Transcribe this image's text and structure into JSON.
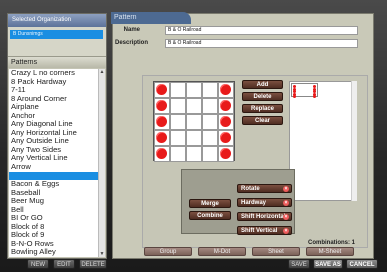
{
  "left_panel": {
    "org_header": "Selected Organization",
    "org_selected": "B Dunsnimgs",
    "patterns_header": "Patterns",
    "patterns": [
      "Crazy L no corners",
      "8 Pack Hardway",
      "7-11",
      "8 Around Corner",
      "Airplane",
      "Anchor",
      "Any Diagonal Line",
      "Any Horizontal Line",
      "Any Outside Line",
      "Any Two Sides",
      "Any Vertical Line",
      "Arrow",
      "B & O Railroad",
      "Bacon & Eggs",
      "Baseball",
      "Beer Mug",
      "Bell",
      "BI Or GO",
      "Block of 8",
      "Block of 9",
      "B-N-O Rows",
      "Bowling Alley",
      "Bracket"
    ],
    "selected_index": 12
  },
  "main": {
    "tab_title": "Pattern",
    "name_label": "Name",
    "name_value": "B & O Railroad",
    "description_label": "Description",
    "description_value": "B & O Railroad",
    "buttons": {
      "add": "Add",
      "delete": "Delete",
      "replace": "Replace",
      "clear": "Clear"
    },
    "ops": {
      "merge": "Merge",
      "combine": "Combine",
      "rotate": "Rotate",
      "hardway": "Hardway",
      "shift_h": "Shift Horizontal",
      "shift_v": "Shift Vertical"
    },
    "combinations_label": "Combinations: 1",
    "tabs": [
      "Group",
      "M-Dot",
      "Sheet",
      "M-Sheet"
    ]
  },
  "bottom": {
    "new": "NEW",
    "edit": "EDIT",
    "delete": "DELETE",
    "save": "SAVE",
    "save_as": "SAVE AS",
    "cancel": "CANCEL"
  },
  "colors": {
    "accent": "#1a8ee2",
    "dot": "#e81a1a",
    "button": "#5e3a2c"
  }
}
